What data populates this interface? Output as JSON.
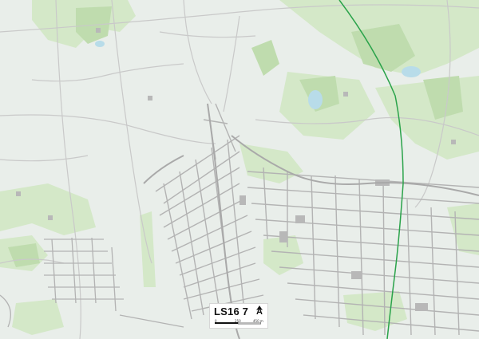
{
  "map": {
    "postcode_label": "LS16 7",
    "north_symbol": "A",
    "scale": {
      "labels": [
        "0",
        "250",
        "450 m"
      ]
    },
    "colors": {
      "background": "#e9eeea",
      "green_space": "#d4e8c8",
      "dark_green": "#bfdcae",
      "water": "#b8dce9",
      "streets": "#c9c9c9",
      "buildings": "#b3b3b3",
      "railway": "#2aa34a"
    }
  }
}
